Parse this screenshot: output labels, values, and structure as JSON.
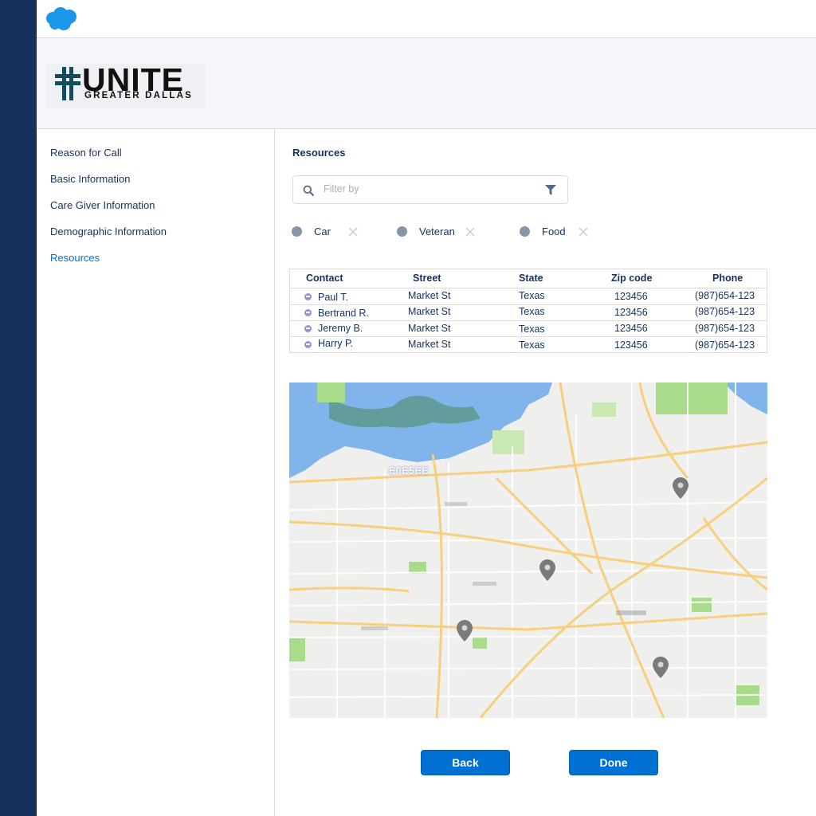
{
  "brand": {
    "logo_title": "UNITE",
    "logo_subtitle": "GREATER DALLAS",
    "cloud_icon": "salesforce-cloud-icon",
    "cloud_color": "#1b96e8"
  },
  "sidebar": {
    "items": [
      {
        "label": "Reason for Call",
        "active": false
      },
      {
        "label": "Basic Information",
        "active": false
      },
      {
        "label": "Care Giver Information",
        "active": false
      },
      {
        "label": "Demographic Information",
        "active": false
      },
      {
        "label": "Resources",
        "active": true
      }
    ]
  },
  "resources": {
    "title": "Resources",
    "filter": {
      "placeholder": "Filter by",
      "value": "",
      "search_icon": "search-icon",
      "filter_icon": "funnel-icon"
    },
    "chips": [
      {
        "label": "Car"
      },
      {
        "label": "Veteran"
      },
      {
        "label": "Food"
      }
    ],
    "table": {
      "headers": [
        "Contact",
        "Street",
        "State",
        "Zip code",
        "Phone"
      ],
      "rows": [
        {
          "contact": "Paul T.",
          "street": "Market St",
          "state": "Texas",
          "zip": "123456",
          "phone": "(987)654-123"
        },
        {
          "contact": "Bertrand R.",
          "street": "Market St",
          "state": "Texas",
          "zip": "123456",
          "phone": "(987)654-123"
        },
        {
          "contact": "Jeremy B.",
          "street": "Market St",
          "state": "Texas",
          "zip": "123456",
          "phone": "(987)654-123"
        },
        {
          "contact": "Harry P.",
          "street": "Market St",
          "state": "Texas",
          "zip": "123456",
          "phone": "(987)654-123"
        }
      ]
    },
    "map": {
      "label": "E0E5EE",
      "marker_icon": "map-pin-icon",
      "colors": {
        "water": "#80b4ea",
        "land": "#efefed",
        "road": "#f7cf7e",
        "park": "#a9dc8a"
      }
    }
  },
  "actions": {
    "back_label": "Back",
    "done_label": "Done",
    "primary_color": "#0070d2"
  },
  "colors": {
    "rail": "#16325c",
    "text": "#16325c",
    "active": "#0070d2",
    "border": "#dddbda"
  }
}
